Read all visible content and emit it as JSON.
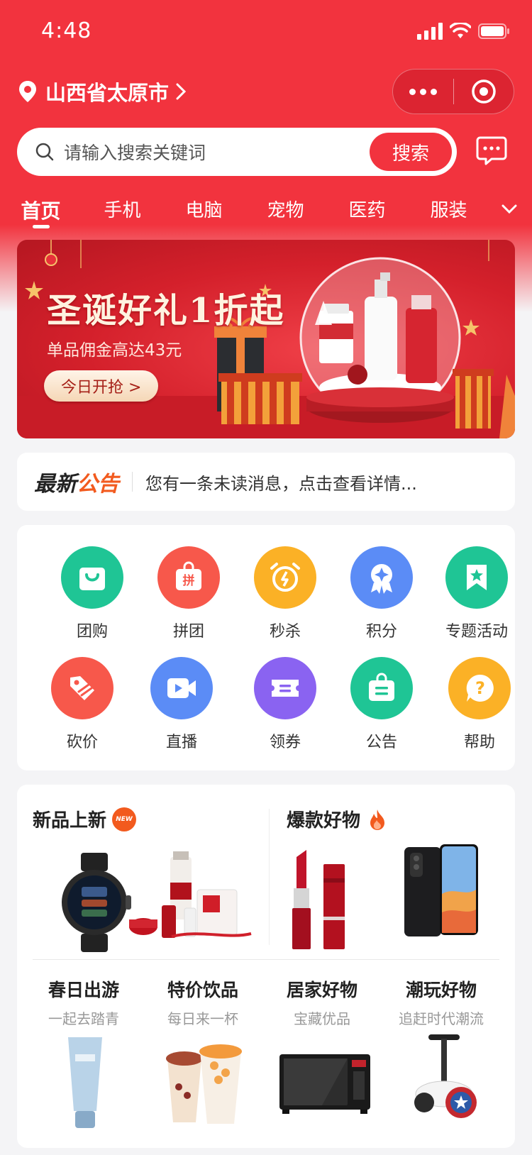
{
  "status": {
    "time": "4:48"
  },
  "location": {
    "city": "山西省太原市"
  },
  "search": {
    "placeholder": "请输入搜索关键词",
    "button": "搜索"
  },
  "tabs": [
    "首页",
    "手机",
    "电脑",
    "宠物",
    "医药",
    "服装"
  ],
  "banner": {
    "title": "圣诞好礼1折起",
    "subtitle": "单品佣金高达43元",
    "button": "今日开抢 >"
  },
  "notice": {
    "label_a": "最新",
    "label_b": "公告",
    "text": "您有一条未读消息，点击查看详情..."
  },
  "quick_menu": [
    {
      "label": "团购",
      "icon": "shopping-bag-icon",
      "color": "#1fc595"
    },
    {
      "label": "拼团",
      "icon": "pin-group-icon",
      "color": "#f7584b"
    },
    {
      "label": "秒杀",
      "icon": "alarm-clock-icon",
      "color": "#fbb126"
    },
    {
      "label": "积分",
      "icon": "medal-icon",
      "color": "#5b8cf6"
    },
    {
      "label": "专题活动",
      "icon": "bookmark-star-icon",
      "color": "#1fc595"
    },
    {
      "label": "砍价",
      "icon": "price-tag-icon",
      "color": "#f7584b"
    },
    {
      "label": "直播",
      "icon": "video-camera-icon",
      "color": "#5b8cf6"
    },
    {
      "label": "领券",
      "icon": "coupon-icon",
      "color": "#8a63f1"
    },
    {
      "label": "公告",
      "icon": "notice-bag-icon",
      "color": "#1fc595"
    },
    {
      "label": "帮助",
      "icon": "help-question-icon",
      "color": "#fbb126"
    }
  ],
  "sections": {
    "new": {
      "title": "新品上新",
      "badge": "NEW"
    },
    "hot": {
      "title": "爆款好物"
    },
    "categories": [
      {
        "title": "春日出游",
        "subtitle": "一起去踏青"
      },
      {
        "title": "特价饮品",
        "subtitle": "每日来一杯"
      },
      {
        "title": "居家好物",
        "subtitle": "宝藏优品"
      },
      {
        "title": "潮玩好物",
        "subtitle": "追赶时代潮流"
      }
    ]
  },
  "colors": {
    "brand": "#f2333e",
    "notice_accent": "#f25a1e"
  }
}
